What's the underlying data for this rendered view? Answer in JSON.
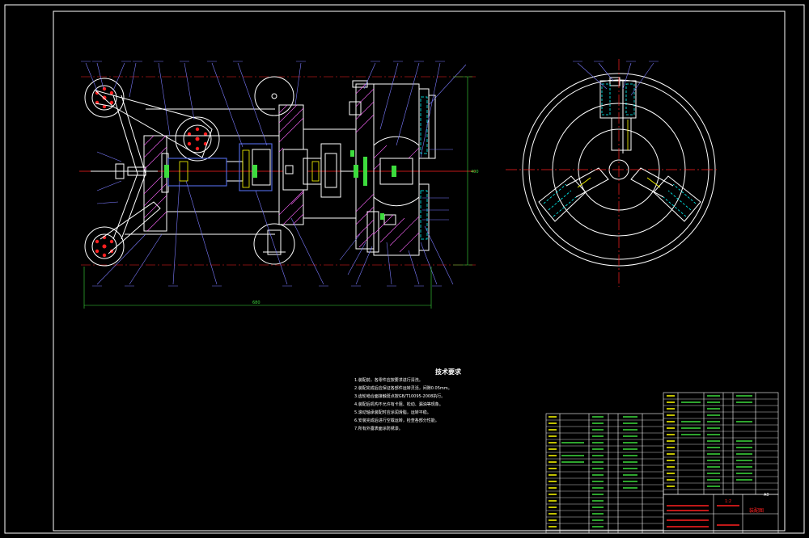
{
  "drawing": {
    "line_color": "#ffffff",
    "center_line_color": "#ff2020",
    "dim_color": "#3ddc3d",
    "leader_color": "#7b7bff",
    "hatch_color": "#ff66ff",
    "blue_color": "#3355ff",
    "cyan_color": "#00ffff",
    "yellow_color": "#ffff00"
  },
  "tech_notes": {
    "title": "技术要求",
    "items": [
      "1.装配前，各零件应按要求进行清洗。",
      "2.装配完成后应保证各部件运转灵活，间隙0.05mm。",
      "3.齿轮啮合面接触斑点按GB/T10095-2008执行。",
      "4.装配后机构不允许有卡阻、松动、漏油等现象。",
      "5.滚动轴承装配时应涂润滑脂，运转平稳。",
      "6.安装完成后进行空载运转，检查各部分性能。",
      "7.所有外露表面涂防锈漆。"
    ]
  },
  "dimensions": {
    "width": "680",
    "height": "400"
  },
  "title_block": {
    "ratio": "1:2",
    "sheet": "A0",
    "stamp": "装配图"
  }
}
